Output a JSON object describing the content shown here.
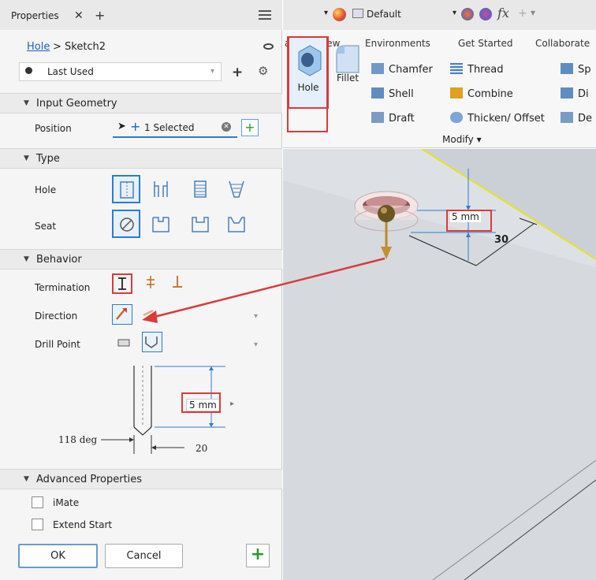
{
  "panel": {
    "tab_title": "Properties",
    "tab_close": "✕",
    "tab_add": "+",
    "breadcrumb_link": "Hole",
    "breadcrumb_sep": ">",
    "breadcrumb_current": "Sketch2",
    "preset_label": "Last Used",
    "preset_add": "+",
    "gear": "⚙"
  },
  "sections": {
    "input_geometry": "Input Geometry",
    "type": "Type",
    "behavior": "Behavior",
    "advanced": "Advanced Properties"
  },
  "input_geometry": {
    "position_label": "Position",
    "selection_text": "1 Selected"
  },
  "type_rows": {
    "hole_label": "Hole",
    "seat_label": "Seat"
  },
  "behavior": {
    "termination_label": "Termination",
    "direction_label": "Direction",
    "drill_point_label": "Drill Point"
  },
  "drawing": {
    "depth_value": "5 mm",
    "angle_label": "118 deg",
    "diameter_label": "20"
  },
  "advanced": {
    "imate_label": "iMate",
    "extend_start_label": "Extend Start"
  },
  "buttons": {
    "ok": "OK",
    "cancel": "Cancel",
    "apply": "+"
  },
  "qat": {
    "appearance": "Default",
    "fx": "fx"
  },
  "ribbon": {
    "tabs": [
      "age",
      "View",
      "Environments",
      "Get Started",
      "Collaborate"
    ],
    "hole": "Hole",
    "fillet": "Fillet",
    "chamfer": "Chamfer",
    "thread": "Thread",
    "shell": "Shell",
    "combine": "Combine",
    "draft": "Draft",
    "thicken": "Thicken/ Offset",
    "sp": "Sp",
    "di": "Di",
    "de": "De",
    "modify": "Modify ▾"
  },
  "viewport": {
    "dim_depth": "5 mm",
    "dim_offset": "30"
  },
  "colors": {
    "highlight": "#d93b3b",
    "accent": "#2b7cd3",
    "viewport": "#cbd0d6"
  }
}
